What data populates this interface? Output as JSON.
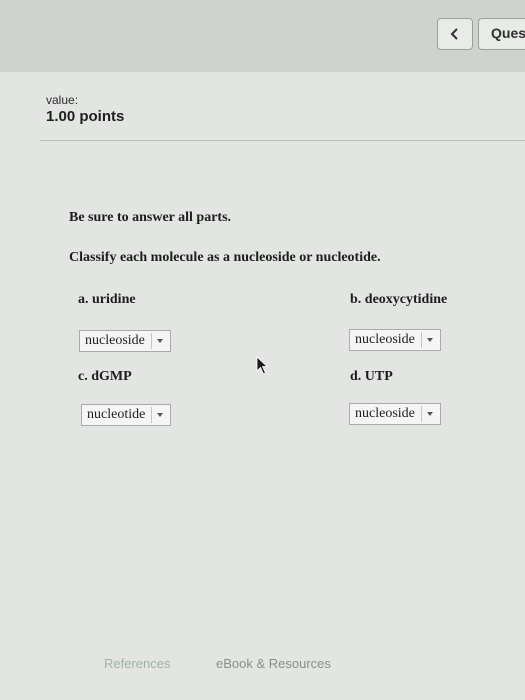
{
  "header": {
    "prev_icon": "chevron-left-icon",
    "question_label": "Ques"
  },
  "score": {
    "value_label": "value:",
    "points": "1.00 points"
  },
  "question": {
    "instruction": "Be sure to answer all parts.",
    "prompt": "Classify each molecule as a nucleoside or nucleotide.",
    "parts": [
      {
        "label": "a. uridine",
        "selected": "nucleoside"
      },
      {
        "label": "b. deoxycytidine",
        "selected": "nucleoside"
      },
      {
        "label": "c. dGMP",
        "selected": "nucleotide"
      },
      {
        "label": "d. UTP",
        "selected": "nucleoside"
      }
    ]
  },
  "footer": {
    "references": "References",
    "ebook": "eBook & Resources"
  }
}
